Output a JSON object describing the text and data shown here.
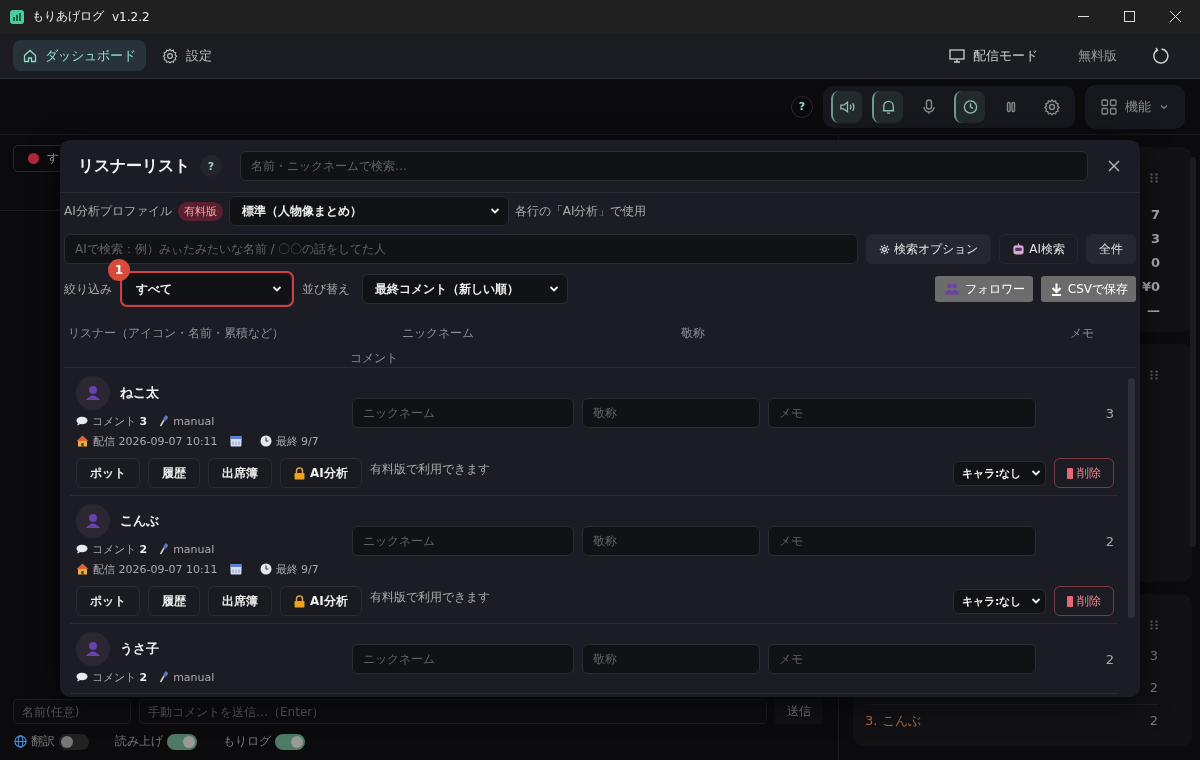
{
  "window": {
    "title": "もりあげログ",
    "version": "v1.2.2"
  },
  "nav": {
    "tabs": [
      {
        "label": "ダッシュボード",
        "kind": "home",
        "selected": true
      },
      {
        "label": "設定",
        "kind": "gear",
        "selected": false
      }
    ],
    "stream_mode": "配信モード",
    "plan": "無料版"
  },
  "toolbar": {
    "help": "?",
    "toggles": [
      {
        "kind": "speaker",
        "on": true
      },
      {
        "kind": "bell",
        "on": true
      },
      {
        "kind": "mic",
        "on": false
      },
      {
        "kind": "clock",
        "on": true
      },
      {
        "kind": "pause",
        "on": false
      },
      {
        "kind": "gear",
        "on": false
      }
    ],
    "features": "機能"
  },
  "background": {
    "filter_chip": "す",
    "stats": [
      "7",
      "3",
      "0",
      "¥0",
      "—"
    ],
    "ranking_counts": [
      "3",
      "2"
    ],
    "ranking_rows": [
      {
        "label": "3. こんぶ",
        "count": "2"
      }
    ],
    "comment_bar": {
      "name_placeholder": "名前(任意)",
      "comment_placeholder": "手動コメントを送信…（Enter）",
      "send": "送信"
    },
    "switches": [
      {
        "label": "翻訳",
        "globe": true,
        "on": false
      },
      {
        "label": "読み上げ",
        "globe": false,
        "on": true
      },
      {
        "label": "もりログ",
        "globe": false,
        "on": true
      }
    ]
  },
  "modal": {
    "title": "リスナーリスト",
    "help": "?",
    "search_placeholder": "名前・ニックネームで検索…",
    "ai_profile": {
      "label": "AI分析プロファイル",
      "badge": "有料版",
      "value": "標準（人物像まとめ）",
      "note": "各行の「AI分析」で使用"
    },
    "ai_search": {
      "placeholder": "AIで検索：例）みぃたみたいな名前 / 〇〇の話をしてた人",
      "options": "検索オプション",
      "ai_button": "AI検索",
      "all_button": "全件"
    },
    "filter": {
      "label": "絞り込み",
      "value": "すべて",
      "annotation": "1"
    },
    "sort": {
      "label": "並び替え",
      "value": "最終コメント（新しい順）"
    },
    "follower": "フォロワー",
    "csv": "CSVで保存",
    "columns": [
      "リスナー（アイコン・名前・累積など）",
      "ニックネーム",
      "敬称",
      "メモ",
      "コメント"
    ],
    "listeners": [
      {
        "name": "ねこ太",
        "comment_label": "コメント",
        "comments": "3",
        "source": "manual",
        "stream": "配信 2026-09-07 10:11",
        "last": "最終 9/7",
        "nickname_placeholder": "ニックネーム",
        "honorific_placeholder": "敬称",
        "memo_placeholder": "メモ",
        "count": "3",
        "actions": [
          {
            "label": "ポット",
            "locked": false
          },
          {
            "label": "履歴",
            "locked": false
          },
          {
            "label": "出席簿",
            "locked": false
          },
          {
            "label": "AI分析",
            "locked": true
          }
        ],
        "locked_note": "有料版で利用できます",
        "character": "キャラ:なし",
        "delete": "削除"
      },
      {
        "name": "こんぶ",
        "comment_label": "コメント",
        "comments": "2",
        "source": "manual",
        "stream": "配信 2026-09-07 10:11",
        "last": "最終 9/7",
        "nickname_placeholder": "ニックネーム",
        "honorific_placeholder": "敬称",
        "memo_placeholder": "メモ",
        "count": "2",
        "actions": [
          {
            "label": "ポット",
            "locked": false
          },
          {
            "label": "履歴",
            "locked": false
          },
          {
            "label": "出席簿",
            "locked": false
          },
          {
            "label": "AI分析",
            "locked": true
          }
        ],
        "locked_note": "有料版で利用できます",
        "character": "キャラ:なし",
        "delete": "削除"
      },
      {
        "name": "うさ子",
        "comment_label": "コメント",
        "comments": "2",
        "source": "manual",
        "nickname_placeholder": "ニックネーム",
        "honorific_placeholder": "敬称",
        "memo_placeholder": "メモ",
        "count": "2"
      }
    ]
  }
}
